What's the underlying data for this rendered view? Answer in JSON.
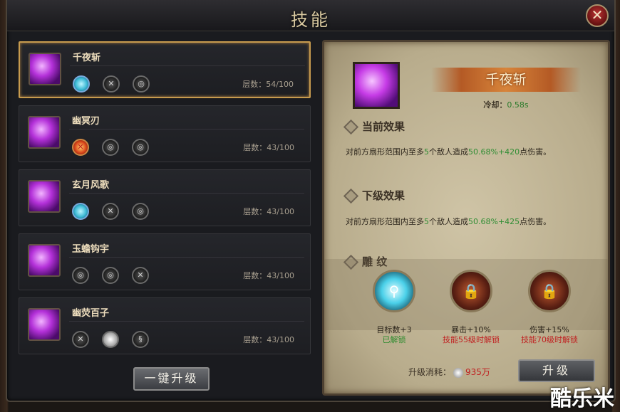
{
  "window": {
    "title": "技能",
    "close_icon": "close-icon"
  },
  "skills": [
    {
      "name": "千夜斩",
      "layers": "层数：54/100",
      "runes": [
        "blue",
        "x",
        "swirl"
      ],
      "selected": true
    },
    {
      "name": "幽冥刃",
      "layers": "层数：43/100",
      "runes": [
        "red",
        "swirl",
        "swirl"
      ],
      "selected": false
    },
    {
      "name": "玄月风歌",
      "layers": "层数：43/100",
      "runes": [
        "blue",
        "x",
        "swirl"
      ],
      "selected": false
    },
    {
      "name": "玉蟾钩宇",
      "layers": "层数：43/100",
      "runes": [
        "swirl",
        "swirl",
        "x"
      ],
      "selected": false
    },
    {
      "name": "幽荧百子",
      "layers": "层数：43/100",
      "runes": [
        "x",
        "white",
        "claw"
      ],
      "selected": false
    }
  ],
  "one_key_upgrade": "一键升级",
  "detail": {
    "skill_name": "千夜斩",
    "cooldown_label": "冷却：",
    "cooldown_value": "0.58s",
    "current_effect_title": "当前效果",
    "current_effect_a": "对前方扇形范围内至多",
    "current_effect_n": "5",
    "current_effect_b": "个敌人造成",
    "current_effect_dmg": "50.68%+420",
    "current_effect_c": "点伤害。",
    "next_effect_title": "下级效果",
    "next_effect_a": "对前方扇形范围内至多",
    "next_effect_n": "5",
    "next_effect_b": "个敌人造成",
    "next_effect_dmg": "50.68%+425",
    "next_effect_c": "点伤害。",
    "engrave_title": "雕 纹",
    "engraves": [
      {
        "label": "目标数+3",
        "status": "已解锁",
        "state": "unlocked"
      },
      {
        "label": "暴击+10%",
        "status": "技能55级时解锁",
        "state": "locked"
      },
      {
        "label": "伤害+15%",
        "status": "技能70级时解锁",
        "state": "locked"
      }
    ],
    "cost_label": "升级消耗：",
    "cost_amount": "935万",
    "upgrade_button": "升级"
  },
  "watermark": "酷乐米"
}
